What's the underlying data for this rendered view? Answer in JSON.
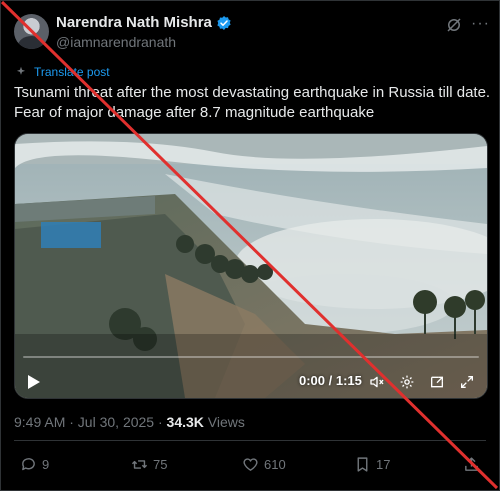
{
  "author": {
    "name": "Narendra Nath Mishra",
    "handle": "@iamnarendranath"
  },
  "translate_link": "Translate post",
  "tweet_text": "Tsunami threat after the most devastating earthquake in Russia till date. Fear of major damage after 8.7 magnitude earthquake",
  "video": {
    "time": "0:00 / 1:15",
    "progress": 0
  },
  "meta": {
    "timestamp": "9:49 AM · Jul 30, 2025 · ",
    "views_count": "34.3K",
    "views_label": " Views"
  },
  "actions": {
    "replies": "9",
    "reposts": "75",
    "likes": "610",
    "bookmarks": "17"
  },
  "colors": {
    "accent": "#1d9bf0",
    "strike": "#e0302e"
  },
  "icons": [
    "verified-badge-icon",
    "grok-icon",
    "more-icon",
    "translate-icon",
    "play-icon",
    "volume-icon",
    "settings-icon",
    "pip-icon",
    "fullscreen-icon",
    "reply-icon",
    "repost-icon",
    "like-icon",
    "bookmark-icon",
    "share-icon"
  ]
}
